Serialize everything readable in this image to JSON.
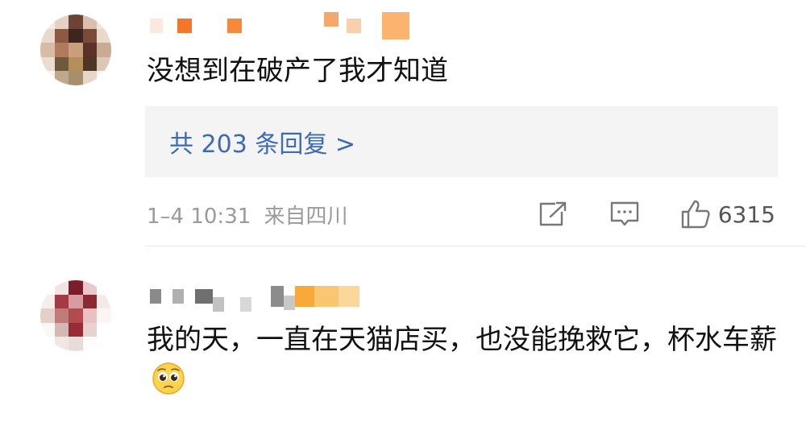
{
  "comments": [
    {
      "text": "没想到在破产了我才知道",
      "replies_label": "共 203 条回复 >",
      "timestamp": "1–4 10:31",
      "location": "来自四川",
      "like_count": "6315"
    },
    {
      "text": "我的天，一直在天猫店买，也没能挽救它，杯水车薪"
    }
  ],
  "icons": {
    "share": "share-icon",
    "comment": "comment-icon",
    "like": "thumbs-up-icon",
    "emoji": "pleading-face-emoji"
  },
  "colors": {
    "reply_link": "#3d6ab6",
    "meta_gray": "#9a9a9a",
    "reply_bg": "#f4f4f4"
  }
}
